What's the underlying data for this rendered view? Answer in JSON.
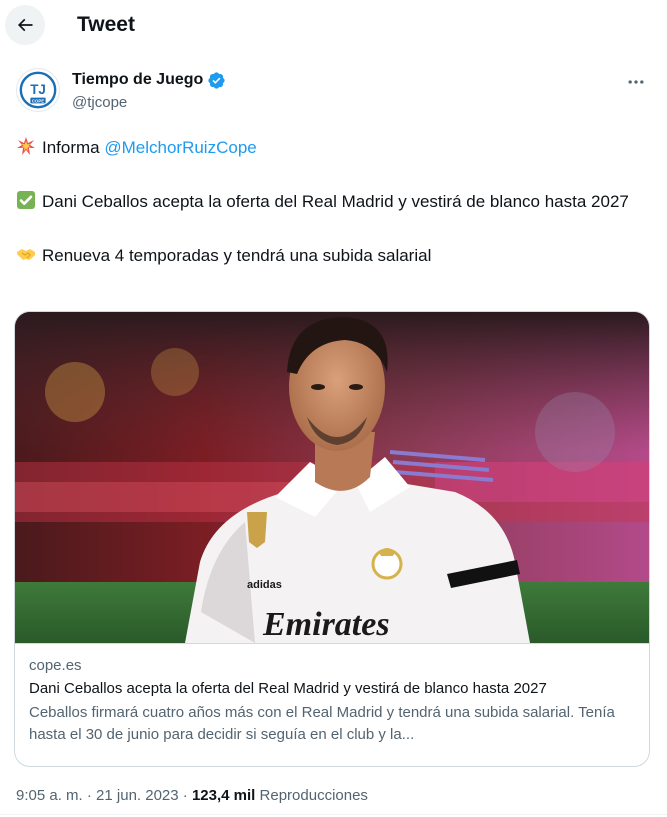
{
  "header": {
    "title": "Tweet",
    "back_icon": "arrow-left-icon"
  },
  "author": {
    "name": "Tiempo de Juego",
    "handle": "@tjcope",
    "verified": true,
    "avatar_monogram": "TJ",
    "avatar_caption": "COPE"
  },
  "tweet": {
    "line1_prefix": "Informa ",
    "line1_mention": "@MelchorRuizCope",
    "line2": "Dani Ceballos acepta la oferta del Real Madrid y vestirá de blanco hasta 2027",
    "line3": "Renueva 4 temporadas y tendrá una subida salarial"
  },
  "card": {
    "domain": "cope.es",
    "title": "Dani Ceballos acepta la oferta del Real Madrid y vestirá de blanco hasta 2027",
    "description": "Ceballos firmará cuatro años más con el Real Madrid y tendrá una subida salarial. Tenía hasta el 30 de junio para decidir si seguía en el club y la...",
    "sponsor_text": "Emirates",
    "sponsor_brand": "adidas"
  },
  "meta": {
    "time": "9:05 a. m.",
    "sep1": "·",
    "date": "21 jun. 2023",
    "sep2": "·",
    "views_count": "123,4 mil",
    "views_label": "Reproducciones"
  },
  "colors": {
    "accent": "#1d9bf0",
    "text": "#0f1419",
    "muted": "#536471",
    "border": "#cfd9de"
  }
}
